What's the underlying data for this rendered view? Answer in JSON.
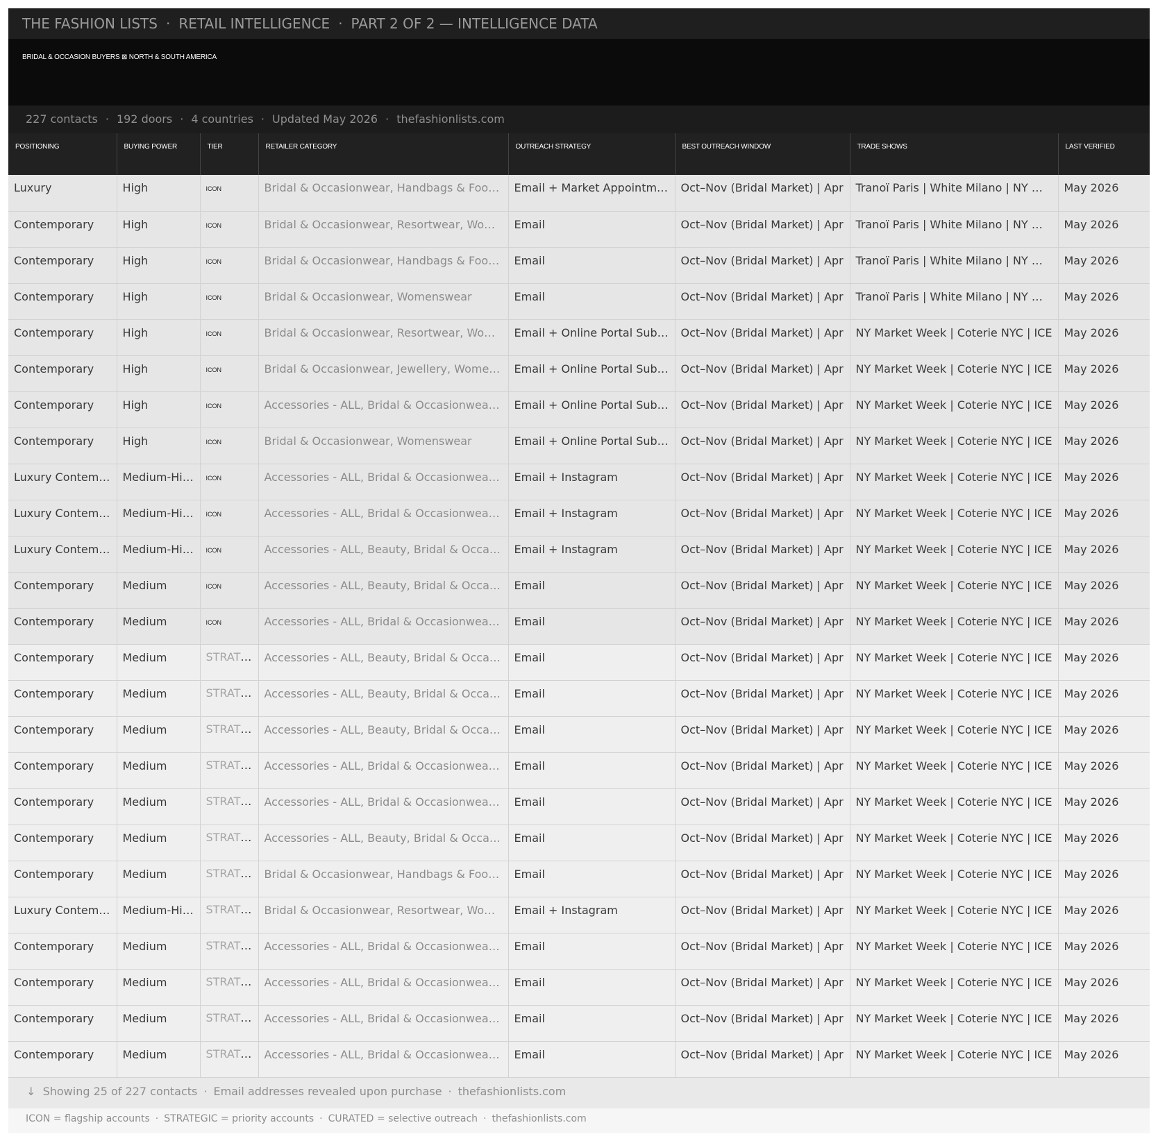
{
  "header": {
    "brand": "THE FASHION LISTS",
    "section": "RETAIL INTELLIGENCE",
    "part": "PART 2 OF 2 — INTELLIGENCE DATA",
    "separator": "·"
  },
  "banner": {
    "subtitle": "BRIDAL & OCCASION BUYERS ⊠ NORTH & SOUTH AMERICA"
  },
  "stats": {
    "contacts": "227 contacts",
    "doors": "192 doors",
    "countries": "4 countries",
    "updated": "Updated May 2026",
    "site": "thefashionlists.com"
  },
  "table": {
    "columns": [
      "POSITIONING",
      "BUYING POWER",
      "TIER",
      "RETAILER CATEGORY",
      "OUTREACH STRATEGY",
      "BEST OUTREACH WINDOW",
      "TRADE SHOWS",
      "LAST VERIFIED"
    ],
    "rows": [
      {
        "positioning": "Luxury",
        "buying_power": "High",
        "tier": "ICON",
        "category": "Bridal & Occasionwear, Handbags & Footwear",
        "outreach": "Email + Market Appointment",
        "window": "Oct–Nov (Bridal Market) | Apr",
        "trade_shows": "Tranoï Paris | White Milano | NY Market Week",
        "verified": "May 2026"
      },
      {
        "positioning": "Contemporary",
        "buying_power": "High",
        "tier": "ICON",
        "category": "Bridal & Occasionwear, Resortwear, Womenswear",
        "outreach": "Email",
        "window": "Oct–Nov (Bridal Market) | Apr",
        "trade_shows": "Tranoï Paris | White Milano | NY Market Week",
        "verified": "May 2026"
      },
      {
        "positioning": "Contemporary",
        "buying_power": "High",
        "tier": "ICON",
        "category": "Bridal & Occasionwear, Handbags & Footwear",
        "outreach": "Email",
        "window": "Oct–Nov (Bridal Market) | Apr",
        "trade_shows": "Tranoï Paris | White Milano | NY Market Week",
        "verified": "May 2026"
      },
      {
        "positioning": "Contemporary",
        "buying_power": "High",
        "tier": "ICON",
        "category": "Bridal & Occasionwear, Womenswear",
        "outreach": "Email",
        "window": "Oct–Nov (Bridal Market) | Apr",
        "trade_shows": "Tranoï Paris | White Milano | NY Market Week",
        "verified": "May 2026"
      },
      {
        "positioning": "Contemporary",
        "buying_power": "High",
        "tier": "ICON",
        "category": "Bridal & Occasionwear, Resortwear, Womenswear",
        "outreach": "Email + Online Portal Submission",
        "window": "Oct–Nov (Bridal Market) | Apr",
        "trade_shows": "NY Market Week | Coterie NYC | ICE",
        "verified": "May 2026"
      },
      {
        "positioning": "Contemporary",
        "buying_power": "High",
        "tier": "ICON",
        "category": "Bridal & Occasionwear, Jewellery, Womenswear",
        "outreach": "Email + Online Portal Submission",
        "window": "Oct–Nov (Bridal Market) | Apr",
        "trade_shows": "NY Market Week | Coterie NYC | ICE",
        "verified": "May 2026"
      },
      {
        "positioning": "Contemporary",
        "buying_power": "High",
        "tier": "ICON",
        "category": "Accessories - ALL, Bridal & Occasionwear, Womenswear",
        "outreach": "Email + Online Portal Submission",
        "window": "Oct–Nov (Bridal Market) | Apr",
        "trade_shows": "NY Market Week | Coterie NYC | ICE",
        "verified": "May 2026"
      },
      {
        "positioning": "Contemporary",
        "buying_power": "High",
        "tier": "ICON",
        "category": "Bridal & Occasionwear, Womenswear",
        "outreach": "Email + Online Portal Submission",
        "window": "Oct–Nov (Bridal Market) | Apr",
        "trade_shows": "NY Market Week | Coterie NYC | ICE",
        "verified": "May 2026"
      },
      {
        "positioning": "Luxury Contemporary",
        "buying_power": "Medium-High",
        "tier": "ICON",
        "category": "Accessories - ALL, Bridal & Occasionwear, Womenswear",
        "outreach": "Email + Instagram",
        "window": "Oct–Nov (Bridal Market) | Apr",
        "trade_shows": "NY Market Week | Coterie NYC | ICE",
        "verified": "May 2026"
      },
      {
        "positioning": "Luxury Contemporary",
        "buying_power": "Medium-High",
        "tier": "ICON",
        "category": "Accessories - ALL, Bridal & Occasionwear, Womenswear",
        "outreach": "Email + Instagram",
        "window": "Oct–Nov (Bridal Market) | Apr",
        "trade_shows": "NY Market Week | Coterie NYC | ICE",
        "verified": "May 2026"
      },
      {
        "positioning": "Luxury Contemporary",
        "buying_power": "Medium-High",
        "tier": "ICON",
        "category": "Accessories - ALL, Beauty, Bridal & Occasionwear",
        "outreach": "Email + Instagram",
        "window": "Oct–Nov (Bridal Market) | Apr",
        "trade_shows": "NY Market Week | Coterie NYC | ICE",
        "verified": "May 2026"
      },
      {
        "positioning": "Contemporary",
        "buying_power": "Medium",
        "tier": "ICON",
        "category": "Accessories - ALL, Beauty, Bridal & Occasionwear",
        "outreach": "Email",
        "window": "Oct–Nov (Bridal Market) | Apr",
        "trade_shows": "NY Market Week | Coterie NYC | ICE",
        "verified": "May 2026"
      },
      {
        "positioning": "Contemporary",
        "buying_power": "Medium",
        "tier": "ICON",
        "category": "Accessories - ALL, Bridal & Occasionwear, Womenswear",
        "outreach": "Email",
        "window": "Oct–Nov (Bridal Market) | Apr",
        "trade_shows": "NY Market Week | Coterie NYC | ICE",
        "verified": "May 2026"
      },
      {
        "positioning": "Contemporary",
        "buying_power": "Medium",
        "tier": "STRATEGIC",
        "category": "Accessories - ALL, Beauty, Bridal & Occasionwear",
        "outreach": "Email",
        "window": "Oct–Nov (Bridal Market) | Apr",
        "trade_shows": "NY Market Week | Coterie NYC | ICE",
        "verified": "May 2026"
      },
      {
        "positioning": "Contemporary",
        "buying_power": "Medium",
        "tier": "STRATEGIC",
        "category": "Accessories - ALL, Beauty, Bridal & Occasionwear",
        "outreach": "Email",
        "window": "Oct–Nov (Bridal Market) | Apr",
        "trade_shows": "NY Market Week | Coterie NYC | ICE",
        "verified": "May 2026"
      },
      {
        "positioning": "Contemporary",
        "buying_power": "Medium",
        "tier": "STRATEGIC",
        "category": "Accessories - ALL, Beauty, Bridal & Occasionwear",
        "outreach": "Email",
        "window": "Oct–Nov (Bridal Market) | Apr",
        "trade_shows": "NY Market Week | Coterie NYC | ICE",
        "verified": "May 2026"
      },
      {
        "positioning": "Contemporary",
        "buying_power": "Medium",
        "tier": "STRATEGIC",
        "category": "Accessories - ALL, Bridal & Occasionwear, Womenswear",
        "outreach": "Email",
        "window": "Oct–Nov (Bridal Market) | Apr",
        "trade_shows": "NY Market Week | Coterie NYC | ICE",
        "verified": "May 2026"
      },
      {
        "positioning": "Contemporary",
        "buying_power": "Medium",
        "tier": "STRATEGIC",
        "category": "Accessories - ALL, Bridal & Occasionwear, Womenswear",
        "outreach": "Email",
        "window": "Oct–Nov (Bridal Market) | Apr",
        "trade_shows": "NY Market Week | Coterie NYC | ICE",
        "verified": "May 2026"
      },
      {
        "positioning": "Contemporary",
        "buying_power": "Medium",
        "tier": "STRATEGIC",
        "category": "Accessories - ALL, Beauty, Bridal & Occasionwear",
        "outreach": "Email",
        "window": "Oct–Nov (Bridal Market) | Apr",
        "trade_shows": "NY Market Week | Coterie NYC | ICE",
        "verified": "May 2026"
      },
      {
        "positioning": "Contemporary",
        "buying_power": "Medium",
        "tier": "STRATEGIC",
        "category": "Bridal & Occasionwear, Handbags & Footwear",
        "outreach": "Email",
        "window": "Oct–Nov (Bridal Market) | Apr",
        "trade_shows": "NY Market Week | Coterie NYC | ICE",
        "verified": "May 2026"
      },
      {
        "positioning": "Luxury Contemporary",
        "buying_power": "Medium-High",
        "tier": "STRATEGIC",
        "category": "Bridal & Occasionwear, Resortwear, Womenswear",
        "outreach": "Email + Instagram",
        "window": "Oct–Nov (Bridal Market) | Apr",
        "trade_shows": "NY Market Week | Coterie NYC | ICE",
        "verified": "May 2026"
      },
      {
        "positioning": "Contemporary",
        "buying_power": "Medium",
        "tier": "STRATEGIC",
        "category": "Accessories - ALL, Bridal & Occasionwear, Womenswear",
        "outreach": "Email",
        "window": "Oct–Nov (Bridal Market) | Apr",
        "trade_shows": "NY Market Week | Coterie NYC | ICE",
        "verified": "May 2026"
      },
      {
        "positioning": "Contemporary",
        "buying_power": "Medium",
        "tier": "STRATEGIC",
        "category": "Accessories - ALL, Bridal & Occasionwear, Womenswear",
        "outreach": "Email",
        "window": "Oct–Nov (Bridal Market) | Apr",
        "trade_shows": "NY Market Week | Coterie NYC | ICE",
        "verified": "May 2026"
      },
      {
        "positioning": "Contemporary",
        "buying_power": "Medium",
        "tier": "STRATEGIC",
        "category": "Accessories - ALL, Bridal & Occasionwear, Womenswear",
        "outreach": "Email",
        "window": "Oct–Nov (Bridal Market) | Apr",
        "trade_shows": "NY Market Week | Coterie NYC | ICE",
        "verified": "May 2026"
      },
      {
        "positioning": "Contemporary",
        "buying_power": "Medium",
        "tier": "STRATEGIC",
        "category": "Accessories - ALL, Bridal & Occasionwear, Womenswear",
        "outreach": "Email",
        "window": "Oct–Nov (Bridal Market) | Apr",
        "trade_shows": "NY Market Week | Coterie NYC | ICE",
        "verified": "May 2026"
      }
    ]
  },
  "footer": {
    "arrow_icon": "↓",
    "showing": "Showing 25 of 227 contacts",
    "reveal_note": "Email addresses revealed upon purchase",
    "site": "thefashionlists.com",
    "legend": {
      "icon": "ICON = flagship accounts",
      "strategic": "STRATEGIC = priority accounts",
      "curated": "CURATED = selective outreach",
      "site": "thefashionlists.com"
    }
  },
  "colors": {
    "topbar_bg": "#1f1f1f",
    "banner_bg": "#0b0b0b",
    "header_bg": "#212121",
    "icon_row_bg": "#e6e6e6",
    "strategic_row_bg": "#efefef"
  }
}
